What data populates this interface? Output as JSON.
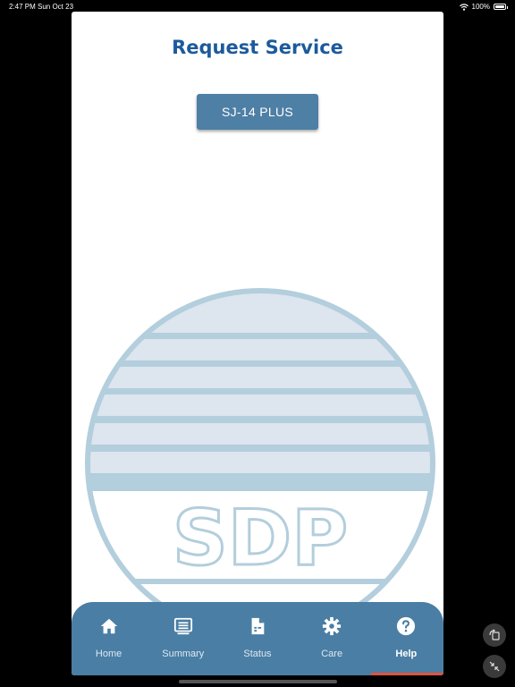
{
  "status_bar": {
    "time": "2:47 PM",
    "date": "Sun Oct 23",
    "battery": "100%"
  },
  "page": {
    "title": "Request Service"
  },
  "device_button": {
    "label": "SJ-14 PLUS"
  },
  "logo": {
    "text": "SDP"
  },
  "nav": {
    "items": [
      {
        "label": "Home",
        "icon": "home-icon"
      },
      {
        "label": "Summary",
        "icon": "list-icon"
      },
      {
        "label": "Status",
        "icon": "document-icon"
      },
      {
        "label": "Care",
        "icon": "gear-icon"
      },
      {
        "label": "Help",
        "icon": "help-icon",
        "active": true
      }
    ]
  },
  "colors": {
    "title": "#1c5a9c",
    "button": "#4e7fa5",
    "nav_bg": "#4a7ea4",
    "active_indicator": "#e0523e",
    "logo": "#b3cedc"
  }
}
